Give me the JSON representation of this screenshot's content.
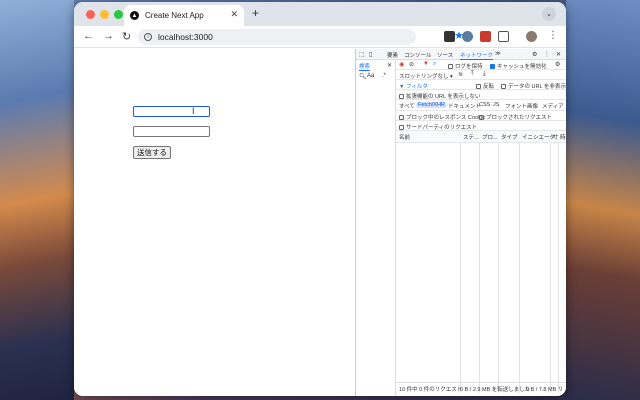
{
  "tab": {
    "title": "Create Next App"
  },
  "toolbar": {
    "url": "localhost:3000"
  },
  "page": {
    "submit_label": "送信する"
  },
  "devtools": {
    "panel_tabs": [
      "要素",
      "コンソール",
      "ソース",
      "ネットワーク",
      "≫"
    ],
    "side_tab": "検索",
    "record_row": {
      "preserve_log": "ログを保持",
      "disable_cache": "キャッシュを無効化",
      "throttling": "スロットリングなし"
    },
    "filter_row": {
      "filter_placeholder": "フィルタ",
      "invert": "反転",
      "hide_data_urls": "データの URL を非表示"
    },
    "hide_extension_urls": "拡張機能の URL を表示しない",
    "type_filters": [
      "すべて",
      "Fetch/XHR",
      "ドキュメント",
      "CSS",
      "JS",
      "フォント",
      "画像",
      "メディア"
    ],
    "blocked_cookies": "ブロック中のレスポンス Cookie",
    "blocked_requests": "ブロックされたリクエスト",
    "third_party": "サードパーティのリクエスト",
    "columns": [
      "名前",
      "ステ...",
      "プロ...",
      "タイプ",
      "イニシエータ",
      "サ",
      "時"
    ],
    "status_bar": {
      "requests": "10 件中 0 件のリクエスト",
      "transferred": "0 B / 2.9 MB を転送しました",
      "resources": "0 B / 7.8 MB リ"
    }
  },
  "colors": {
    "accent": "#1a73e8",
    "focus_border": "#1a5fc7",
    "record_red": "#d93025"
  }
}
